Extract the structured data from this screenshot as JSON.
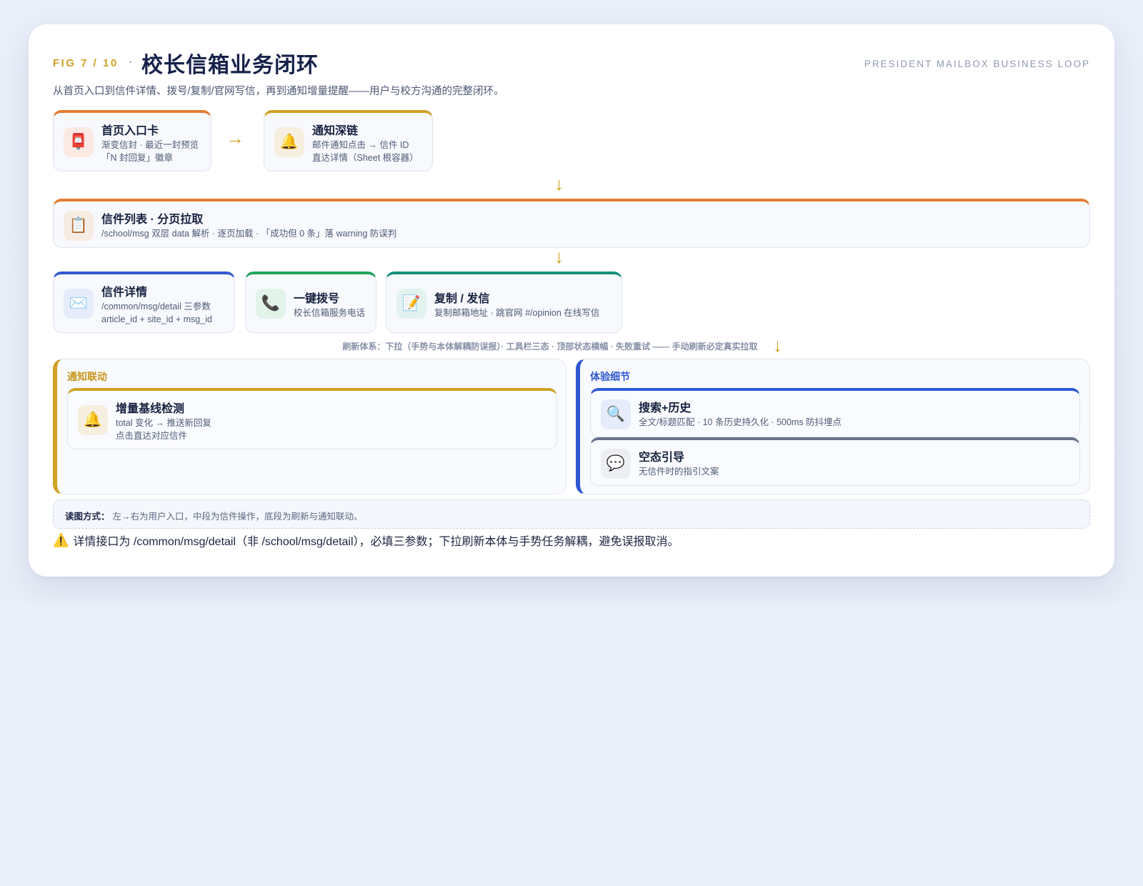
{
  "header": {
    "fig_label": "FIG 7 / 10",
    "separator": "·",
    "title": "校长信箱业务闭环",
    "english_label": "PRESIDENT MAILBOX BUSINESS LOOP",
    "subtitle": "从首页入口到信件详情、拨号/复制/官网写信，再到通知增量提醒——用户与校方沟通的完整闭环。"
  },
  "nodes": {
    "home_entry": {
      "icon": "mailbox-icon",
      "title": "首页入口卡",
      "desc1": "渐变信封 · 最近一封预览",
      "desc2": "「N 封回复」徽章"
    },
    "notify_deeplink": {
      "icon": "bell-icon",
      "title": "通知深链",
      "desc1": "邮件通知点击 → 信件 ID",
      "desc2": "直达详情（Sheet 根容器）"
    },
    "letter_list": {
      "icon": "clipboard-icon",
      "title": "信件列表 · 分页拉取",
      "desc1": "/school/msg 双层 data 解析 · 逐页加载 · 「成功但 0 条」落 warning 防误判"
    },
    "letter_detail": {
      "icon": "envelope-icon",
      "title": "信件详情",
      "desc1": "/common/msg/detail 三参数",
      "desc2": "article_id + site_id + msg_id"
    },
    "one_click_dial": {
      "icon": "phone-icon",
      "title": "一键拨号",
      "desc1": "校长信箱服务电话"
    },
    "copy_send": {
      "icon": "memo-icon",
      "title": "复制 / 发信",
      "desc1": "复制邮箱地址 · 跳官网 #/opinion 在线写信"
    }
  },
  "arrows": {
    "right": "→",
    "down": "↓"
  },
  "refresh_system": "刷新体系：下拉（手势与本体解耦防误报）· 工具栏三态 · 顶部状态横幅 · 失败重试 —— 手动刷新必定真实拉取",
  "groups": {
    "notify": {
      "title": "通知联动",
      "item": {
        "icon": "bell-icon",
        "title": "增量基线检测",
        "desc1": "total 变化 → 推送新回复",
        "desc2": "点击直达对应信件"
      }
    },
    "experience": {
      "title": "体验细节",
      "items": [
        {
          "icon": "magnifier-icon",
          "title": "搜索+历史",
          "desc1": "全文/标题匹配 · 10 条历史持久化 · 500ms 防抖埋点"
        },
        {
          "icon": "speech-bubble-icon",
          "title": "空态引导",
          "desc1": "无信件时的指引文案"
        }
      ]
    }
  },
  "note": {
    "label": "读图方式：",
    "text": "左→右为用户入口，中段为信件操作，底段为刷新与通知联动。"
  },
  "warning": {
    "icon": "warning-icon",
    "text": "详情接口为 /common/msg/detail（非 /school/msg/detail），必填三参数；下拉刷新本体与手势任务解耦，避免误报取消。"
  },
  "colors": {
    "orange": "#e67c30",
    "gold": "#cfa124",
    "blue": "#2f58d0",
    "green": "#1fa35a",
    "teal": "#15907c",
    "slate": "#667289"
  }
}
